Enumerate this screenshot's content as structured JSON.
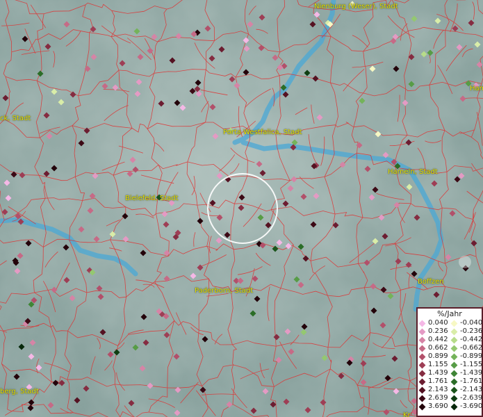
{
  "cities": [
    {
      "id": "nienburg",
      "label": "Nienburg (Weser), Stadt"
    },
    {
      "id": "porta",
      "label": "Porta Westfalica, Stadt"
    },
    {
      "id": "hameln",
      "label": "Hameln, Stadt"
    },
    {
      "id": "bielefeld",
      "label": "Bielefeld, Stadt"
    },
    {
      "id": "paderborn",
      "label": "Paderborn, Stadt"
    },
    {
      "id": "boffzen",
      "label": "Boffzen"
    },
    {
      "id": "ck",
      "label": "ck, Stadt"
    },
    {
      "id": "berg",
      "label": "berg, Stadt"
    },
    {
      "id": "ham",
      "label": "Ham"
    },
    {
      "id": "kr",
      "label": "Kr"
    }
  ],
  "legend": {
    "title": "%/Jahr",
    "positive": [
      {
        "value": "0.040",
        "color": "#f5b8e6"
      },
      {
        "value": "0.236",
        "color": "#e49ac4"
      },
      {
        "value": "0.442",
        "color": "#d684a6"
      },
      {
        "value": "0.662",
        "color": "#c66a86"
      },
      {
        "value": "0.899",
        "color": "#b2506a"
      },
      {
        "value": "1.155",
        "color": "#9e3e55"
      },
      {
        "value": "1.439",
        "color": "#852c41"
      },
      {
        "value": "1.761",
        "color": "#6c1d31"
      },
      {
        "value": "2.143",
        "color": "#551222"
      },
      {
        "value": "2.639",
        "color": "#3c0915"
      },
      {
        "value": "3.690",
        "color": "#23030a"
      }
    ],
    "negative": [
      {
        "value": "-0.040",
        "color": "#f7f8c4"
      },
      {
        "value": "-0.236",
        "color": "#d9eda8"
      },
      {
        "value": "-0.442",
        "color": "#b7dc8a"
      },
      {
        "value": "-0.662",
        "color": "#94c870"
      },
      {
        "value": "-0.899",
        "color": "#74b35a"
      },
      {
        "value": "-1.155",
        "color": "#579c46"
      },
      {
        "value": "-1.439",
        "color": "#3f8536"
      },
      {
        "value": "-1.761",
        "color": "#2b6d27"
      },
      {
        "value": "-2.143",
        "color": "#1b551b"
      },
      {
        "value": "-2.639",
        "color": "#0f3e12"
      },
      {
        "value": "-3.690",
        "color": "#06280a"
      }
    ]
  },
  "colors": {
    "river": "#4aa8d6",
    "borders": "#e03030",
    "selection": "#ffffff",
    "label": "#e8e000"
  }
}
